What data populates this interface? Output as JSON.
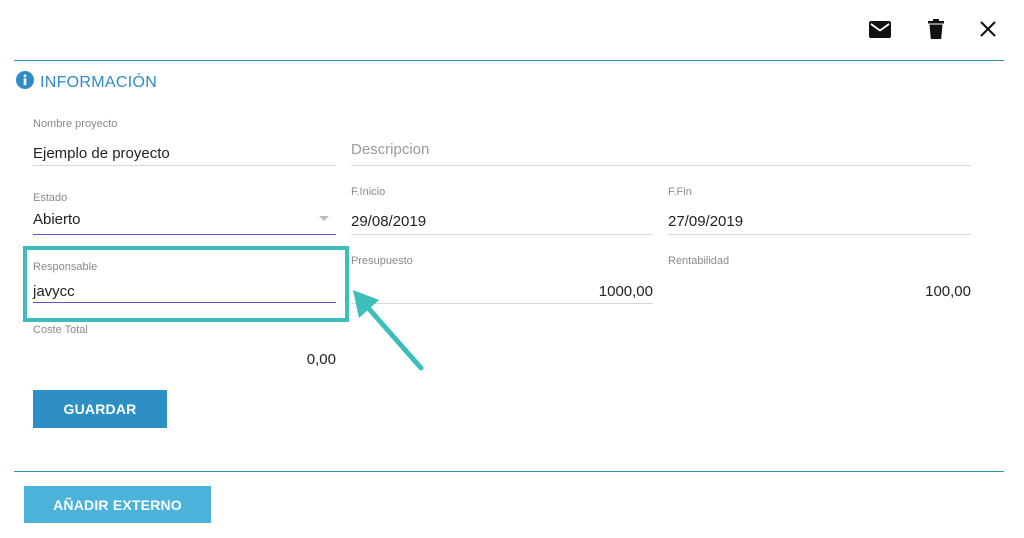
{
  "toolbar": {
    "icons": [
      "email-icon",
      "trash-icon",
      "close-icon"
    ]
  },
  "section": {
    "title": "INFORMACIÓN",
    "icon": "info-icon"
  },
  "form": {
    "nombre_proyecto": {
      "label": "Nombre proyecto",
      "value": "Ejemplo de proyecto"
    },
    "descripcion": {
      "placeholder": "Descripcion"
    },
    "estado": {
      "label": "Estado",
      "value": "Abierto"
    },
    "f_inicio": {
      "label": "F.Inicio",
      "value": "29/08/2019"
    },
    "f_fin": {
      "label": "F.Fin",
      "value": "27/09/2019"
    },
    "responsable": {
      "label": "Responsable",
      "value": "javycc"
    },
    "presupuesto": {
      "label": "Presupuesto",
      "value": "1000,00"
    },
    "rentabilidad": {
      "label": "Rentabilidad",
      "value": "100,00"
    },
    "coste_total": {
      "label": "Coste Total",
      "value": "0,00"
    }
  },
  "buttons": {
    "guardar": "GUARDAR",
    "anadir_externo": "AÑADIR EXTERNO"
  },
  "colors": {
    "accent": "#2e8bc4",
    "divider": "#2a93a8",
    "active_underline": "#6a4fd8",
    "highlight": "#3dbdbc",
    "button_primary": "#2e8fc5",
    "button_secondary": "#4bb2da"
  }
}
